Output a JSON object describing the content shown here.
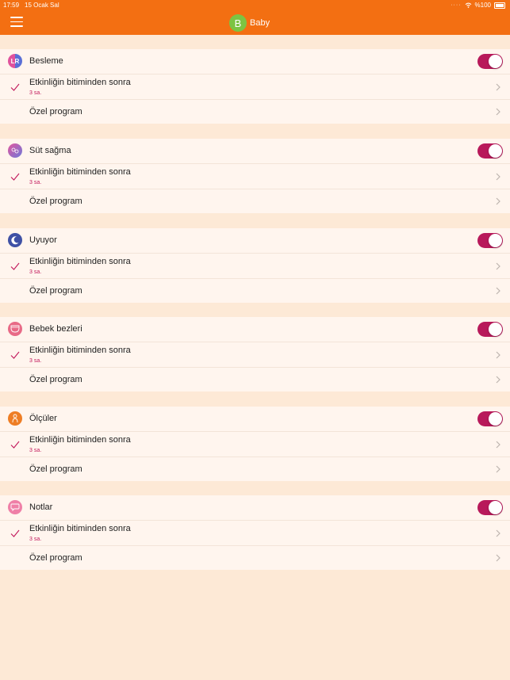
{
  "status_bar": {
    "time": "17:59",
    "date": "15 Ocak Sal",
    "battery": "%100"
  },
  "header": {
    "avatar_letter": "B",
    "title": "Baby"
  },
  "sections": [
    {
      "label": "Besleme",
      "icon": "feeding-lr-icon",
      "enabled": true,
      "option_label": "Etkinliğin bitiminden sonra",
      "option_value": "3 sa.",
      "custom_label": "Özel program"
    },
    {
      "label": "Süt sağma",
      "icon": "breast-pump-icon",
      "enabled": true,
      "option_label": "Etkinliğin bitiminden sonra",
      "option_value": "3 sa.",
      "custom_label": "Özel program"
    },
    {
      "label": "Uyuyor",
      "icon": "moon-icon",
      "enabled": true,
      "option_label": "Etkinliğin bitiminden sonra",
      "option_value": "3 sa.",
      "custom_label": "Özel program"
    },
    {
      "label": "Bebek bezleri",
      "icon": "diaper-icon",
      "enabled": true,
      "option_label": "Etkinliğin bitiminden sonra",
      "option_value": "3 sa.",
      "custom_label": "Özel program"
    },
    {
      "label": "Ölçüler",
      "icon": "growth-icon",
      "enabled": true,
      "option_label": "Etkinliğin bitiminden sonra",
      "option_value": "3 sa.",
      "custom_label": "Özel program"
    },
    {
      "label": "Notlar",
      "icon": "notes-speech-icon",
      "enabled": true,
      "option_label": "Etkinliğin bitiminden sonra",
      "option_value": "3 sa.",
      "custom_label": "Özel program"
    }
  ],
  "colors": {
    "header": "#f36f12",
    "toggle_on": "#b8195a",
    "accent_text": "#c2185b",
    "background": "#fde9d6",
    "row_bg": "#fff5ee"
  }
}
